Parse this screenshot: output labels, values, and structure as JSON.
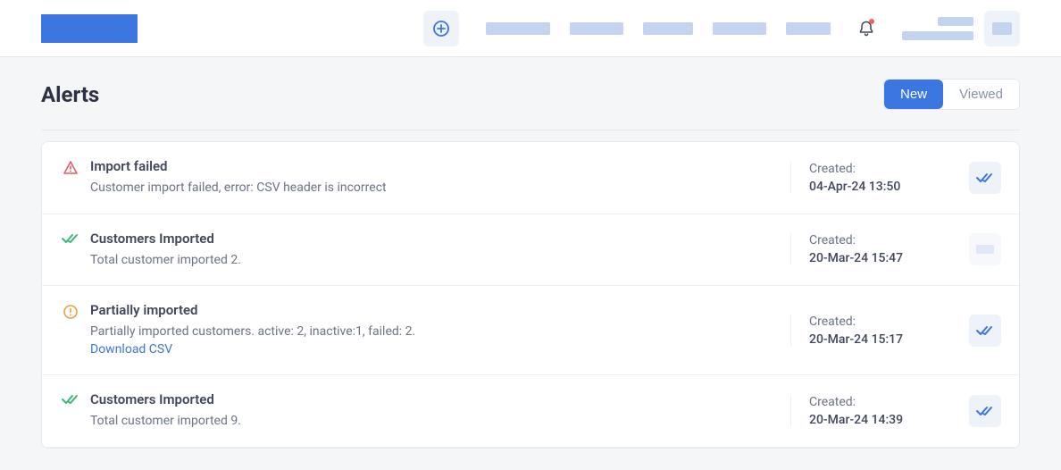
{
  "page": {
    "title": "Alerts"
  },
  "toggle": {
    "new": "New",
    "viewed": "Viewed"
  },
  "alerts": [
    {
      "status": "error",
      "title": "Import failed",
      "desc": "Customer import failed, error: CSV header is incorrect",
      "created_label": "Created:",
      "created_at": "04-Apr-24 13:50",
      "link": null,
      "action": "check"
    },
    {
      "status": "success",
      "title": "Customers Imported",
      "desc": "Total customer imported 2.",
      "created_label": "Created:",
      "created_at": "20-Mar-24 15:47",
      "link": null,
      "action": "placeholder"
    },
    {
      "status": "warning",
      "title": "Partially imported",
      "desc": "Partially imported customers. active: 2, inactive:1, failed: 2.",
      "created_label": "Created:",
      "created_at": "20-Mar-24 15:17",
      "link": "Download CSV",
      "action": "check"
    },
    {
      "status": "success",
      "title": "Customers Imported",
      "desc": "Total customer imported 9.",
      "created_label": "Created:",
      "created_at": "20-Mar-24 14:39",
      "link": null,
      "action": "check"
    }
  ]
}
